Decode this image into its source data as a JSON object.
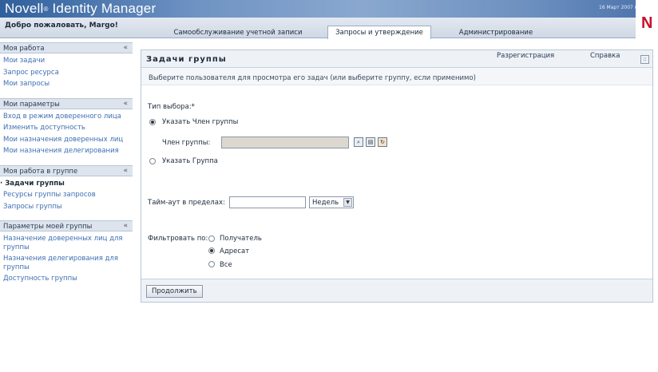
{
  "header": {
    "app_title": "Novell",
    "app_title_rest": " Identity Manager",
    "reg_mark": "®",
    "date": "16 Март 2007 г.",
    "logo_letter": "N",
    "welcome": "Добро пожаловать, Margo!",
    "tabs": [
      {
        "label": "Самообслуживание учетной записи",
        "active": false
      },
      {
        "label": "Запросы и утверждение",
        "active": true
      },
      {
        "label": "Администрирование",
        "active": false
      }
    ]
  },
  "sidebar": {
    "sections": [
      {
        "title": "Моя работа",
        "items": [
          "Мои задачи",
          "Запрос ресурса",
          "Мои запросы"
        ]
      },
      {
        "title": "Мои параметры",
        "items": [
          "Вход в режим доверенного лица",
          "Изменить доступность",
          "Мои назначения доверенных лиц",
          "Мои назначения делегирования"
        ]
      },
      {
        "title": "Моя работа в группе",
        "items": [
          "Задачи группы",
          "Ресурсы группы запросов",
          "Запросы группы"
        ],
        "current_index": 0
      },
      {
        "title": "Параметры моей группы",
        "items": [
          "Назначение доверенных лиц для группы",
          "Назначения делегирования для группы",
          "Доступность группы"
        ]
      }
    ],
    "collapse_glyph": "«"
  },
  "panel": {
    "title": "Задачи группы",
    "logout": "Разрегистрация",
    "help": "Справка",
    "instruction": "Выберите пользователя для просмотра его задач (или выберите группу, если применимо)",
    "selection_type_label": "Тип выбора:*",
    "option_member": "Указать Член группы",
    "member_field_label": "Член группы:",
    "member_field_value": "",
    "option_group": "Указать Группа",
    "timeout_label": "Тайм-аут в пределах:",
    "timeout_value": "",
    "timeout_unit": "Недель",
    "filter_label": "Фильтровать по:",
    "filter_options": [
      "Получатель",
      "Адресат",
      "Все"
    ],
    "filter_selected": "Адресат",
    "continue_button": "Продолжить"
  }
}
